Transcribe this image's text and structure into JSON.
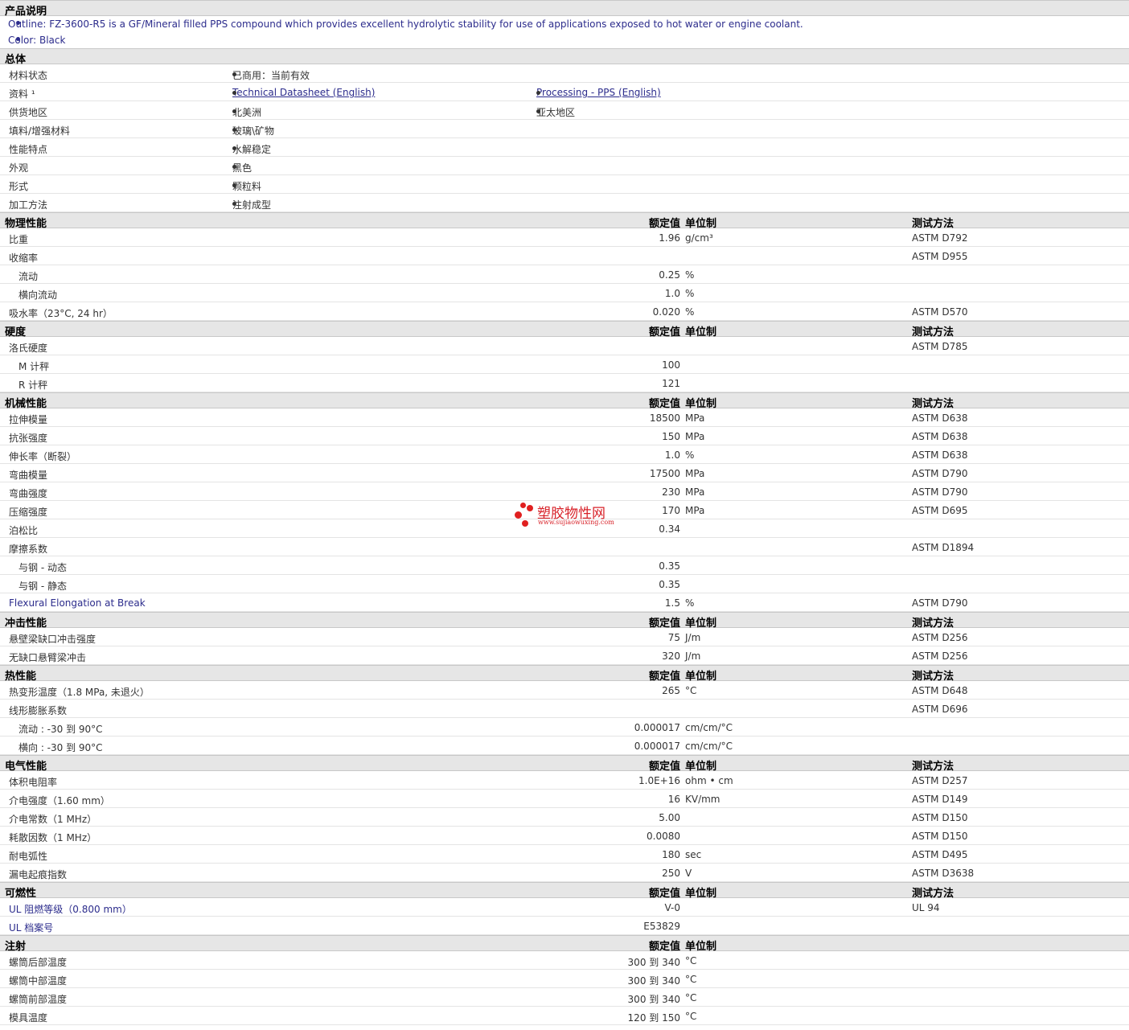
{
  "desc": {
    "title": "产品说明",
    "lines": [
      "Outline: FZ-3600-R5 is a GF/Mineral filled PPS compound which provides excellent hydrolytic stability for use of applications exposed to hot water or engine coolant.",
      "Color: Black"
    ]
  },
  "general": {
    "title": "总体",
    "rows": [
      {
        "label": "材料状态",
        "v1": "已商用：当前有效",
        "v2": ""
      },
      {
        "label": "资料 ¹",
        "v1": "Technical Datasheet (English)",
        "v2": "Processing - PPS (English)"
      },
      {
        "label": "供货地区",
        "v1": "北美洲",
        "v2": "亚太地区"
      },
      {
        "label": "填料/增强材料",
        "v1": "玻璃\\矿物",
        "v2": ""
      },
      {
        "label": "性能特点",
        "v1": "水解稳定",
        "v2": ""
      },
      {
        "label": "外观",
        "v1": "黑色",
        "v2": ""
      },
      {
        "label": "形式",
        "v1": "颗粒料",
        "v2": ""
      },
      {
        "label": "加工方法",
        "v1": "注射成型",
        "v2": ""
      }
    ]
  },
  "headers": {
    "value": "额定值",
    "unit": "单位制",
    "method": "测试方法"
  },
  "sections": [
    {
      "title": "物理性能",
      "method_header": true,
      "rows": [
        {
          "label": "比重",
          "value": "1.96",
          "unit": "g/cm³",
          "method": "ASTM D792"
        },
        {
          "label": "收缩率",
          "value": "",
          "unit": "",
          "method": "ASTM D955"
        },
        {
          "label": "流动",
          "value": "0.25",
          "unit": "%",
          "method": "",
          "sub": true
        },
        {
          "label": "横向流动",
          "value": "1.0",
          "unit": "%",
          "method": "",
          "sub": true
        },
        {
          "label": "吸水率（23°C, 24 hr）",
          "value": "0.020",
          "unit": "%",
          "method": "ASTM D570"
        }
      ]
    },
    {
      "title": "硬度",
      "method_header": true,
      "rows": [
        {
          "label": "洛氏硬度",
          "value": "",
          "unit": "",
          "method": "ASTM D785"
        },
        {
          "label": "M 计秤",
          "value": "100",
          "unit": "",
          "method": "",
          "sub": true
        },
        {
          "label": "R 计秤",
          "value": "121",
          "unit": "",
          "method": "",
          "sub": true
        }
      ]
    },
    {
      "title": "机械性能",
      "method_header": true,
      "rows": [
        {
          "label": "拉伸模量",
          "value": "18500",
          "unit": "MPa",
          "method": "ASTM D638"
        },
        {
          "label": "抗张强度",
          "value": "150",
          "unit": "MPa",
          "method": "ASTM D638"
        },
        {
          "label": "伸长率（断裂）",
          "value": "1.0",
          "unit": "%",
          "method": "ASTM D638"
        },
        {
          "label": "弯曲模量",
          "value": "17500",
          "unit": "MPa",
          "method": "ASTM D790"
        },
        {
          "label": "弯曲强度",
          "value": "230",
          "unit": "MPa",
          "method": "ASTM D790"
        },
        {
          "label": "压缩强度",
          "value": "170",
          "unit": "MPa",
          "method": "ASTM D695"
        },
        {
          "label": "泊松比",
          "value": "0.34",
          "unit": "",
          "method": ""
        },
        {
          "label": "摩擦系数",
          "value": "",
          "unit": "",
          "method": "ASTM D1894"
        },
        {
          "label": "与钢 - 动态",
          "value": "0.35",
          "unit": "",
          "method": "",
          "sub": true
        },
        {
          "label": "与钢 - 静态",
          "value": "0.35",
          "unit": "",
          "method": "",
          "sub": true
        },
        {
          "label": "Flexural Elongation at Break",
          "value": "1.5",
          "unit": "%",
          "method": "ASTM D790",
          "blue": true
        }
      ]
    },
    {
      "title": "冲击性能",
      "method_header": true,
      "rows": [
        {
          "label": "悬壁梁缺口冲击强度",
          "value": "75",
          "unit": "J/m",
          "method": "ASTM D256"
        },
        {
          "label": "无缺口悬臂梁冲击",
          "value": "320",
          "unit": "J/m",
          "method": "ASTM D256"
        }
      ]
    },
    {
      "title": "热性能",
      "method_header": true,
      "rows": [
        {
          "label": "热变形温度（1.8 MPa, 未退火）",
          "value": "265",
          "unit": "°C",
          "method": "ASTM D648"
        },
        {
          "label": "线形膨胀系数",
          "value": "",
          "unit": "",
          "method": "ASTM D696"
        },
        {
          "label": "流动 : -30 到 90°C",
          "value": "0.000017",
          "unit": "cm/cm/°C",
          "method": "",
          "sub": true
        },
        {
          "label": "横向 : -30 到 90°C",
          "value": "0.000017",
          "unit": "cm/cm/°C",
          "method": "",
          "sub": true
        }
      ]
    },
    {
      "title": "电气性能",
      "method_header": true,
      "rows": [
        {
          "label": "体积电阻率",
          "value": "1.0E+16",
          "unit": "ohm • cm",
          "method": "ASTM D257"
        },
        {
          "label": "介电强度（1.60 mm）",
          "value": "16",
          "unit": "KV/mm",
          "method": "ASTM D149"
        },
        {
          "label": "介电常数（1 MHz）",
          "value": "5.00",
          "unit": "",
          "method": "ASTM D150"
        },
        {
          "label": "耗散因数（1 MHz）",
          "value": "0.0080",
          "unit": "",
          "method": "ASTM D150"
        },
        {
          "label": "耐电弧性",
          "value": "180",
          "unit": "sec",
          "method": "ASTM D495"
        },
        {
          "label": "漏电起痕指数",
          "value": "250",
          "unit": "V",
          "method": "ASTM D3638"
        }
      ]
    },
    {
      "title": "可燃性",
      "method_header": true,
      "rows": [
        {
          "label": "UL 阻燃等级（0.800 mm）",
          "value": "V-0",
          "unit": "",
          "method": "UL 94",
          "blue": true
        },
        {
          "label": "UL 档案号",
          "value": "E53829",
          "unit": "",
          "method": "",
          "blue": true
        }
      ]
    },
    {
      "title": "注射",
      "method_header": false,
      "rows": [
        {
          "label": "螺筒后部温度",
          "value": "300 到 340",
          "unit": "°C",
          "method": ""
        },
        {
          "label": "螺筒中部温度",
          "value": "300 到 340",
          "unit": "°C",
          "method": ""
        },
        {
          "label": "螺筒前部温度",
          "value": "300 到 340",
          "unit": "°C",
          "method": ""
        },
        {
          "label": "模具温度",
          "value": "120 到 150",
          "unit": "°C",
          "method": ""
        }
      ]
    }
  ],
  "watermark": {
    "name": "塑胶物性网",
    "url": "www.sujiaowuxing.com"
  }
}
